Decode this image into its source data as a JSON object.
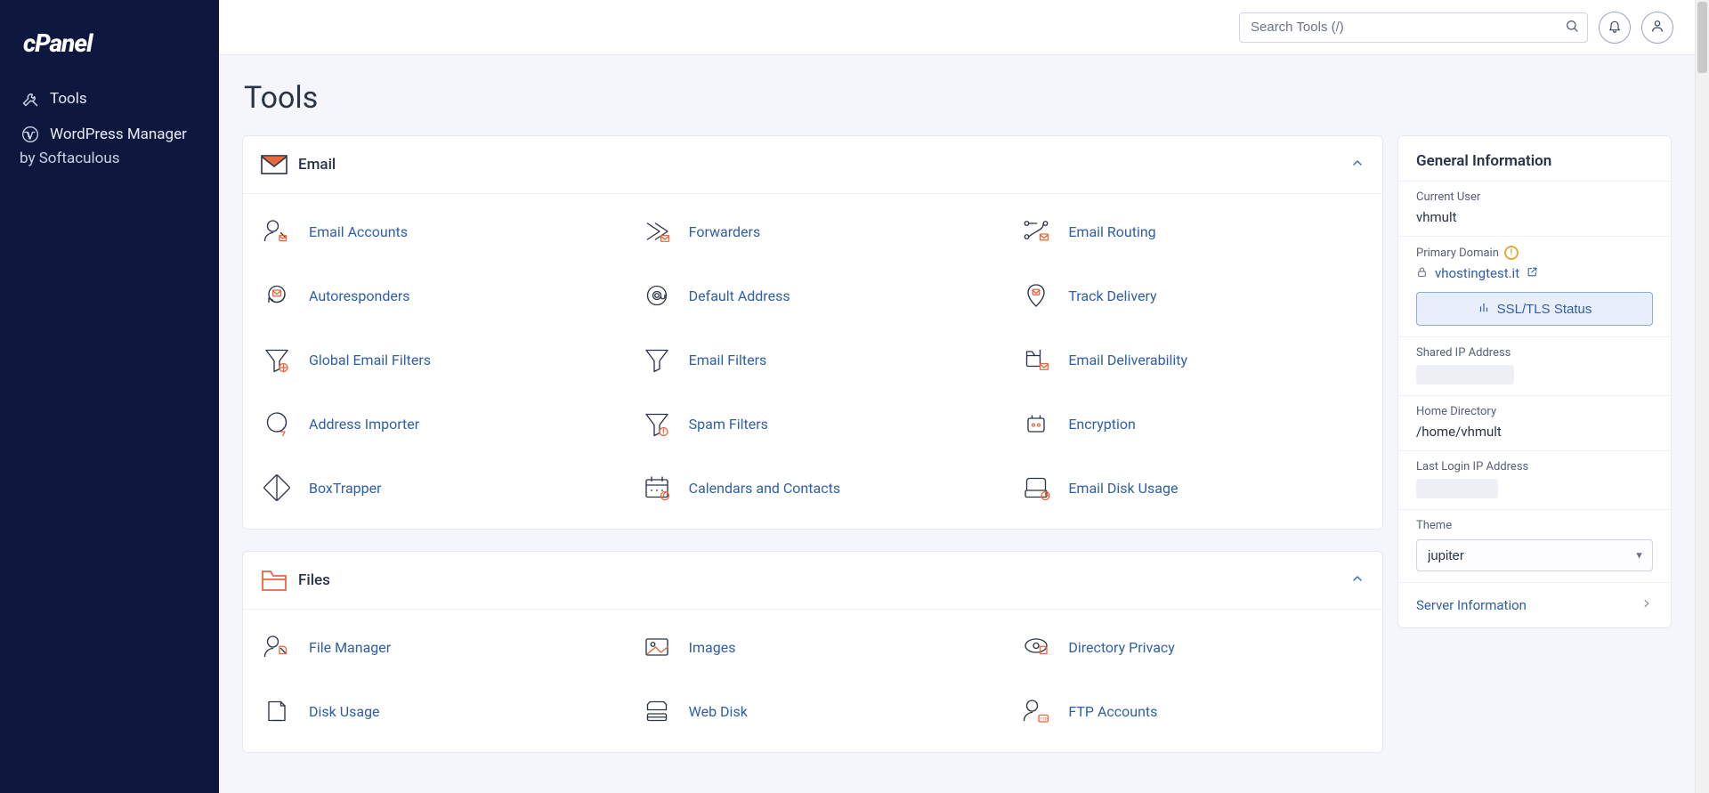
{
  "brand": {
    "name": "cPanel"
  },
  "sidebar": {
    "items": [
      {
        "label": "Tools",
        "icon": "tools"
      },
      {
        "label": "WordPress Manager by Softaculous",
        "icon": "wordpress",
        "label_line1": "WordPress Manager",
        "label_line2": "by Softaculous"
      }
    ]
  },
  "header": {
    "search_placeholder": "Search Tools (/)"
  },
  "page": {
    "title": "Tools"
  },
  "sections": [
    {
      "id": "email",
      "title": "Email",
      "items": [
        {
          "label": "Email Accounts"
        },
        {
          "label": "Forwarders"
        },
        {
          "label": "Email Routing"
        },
        {
          "label": "Autoresponders"
        },
        {
          "label": "Default Address"
        },
        {
          "label": "Track Delivery"
        },
        {
          "label": "Global Email Filters"
        },
        {
          "label": "Email Filters"
        },
        {
          "label": "Email Deliverability"
        },
        {
          "label": "Address Importer"
        },
        {
          "label": "Spam Filters"
        },
        {
          "label": "Encryption"
        },
        {
          "label": "BoxTrapper"
        },
        {
          "label": "Calendars and Contacts"
        },
        {
          "label": "Email Disk Usage"
        }
      ]
    },
    {
      "id": "files",
      "title": "Files",
      "items": [
        {
          "label": "File Manager"
        },
        {
          "label": "Images"
        },
        {
          "label": "Directory Privacy"
        },
        {
          "label": "Disk Usage"
        },
        {
          "label": "Web Disk"
        },
        {
          "label": "FTP Accounts"
        }
      ]
    }
  ],
  "info": {
    "heading": "General Information",
    "current_user_label": "Current User",
    "current_user_value": "vhmult",
    "primary_domain_label": "Primary Domain",
    "primary_domain_value": "vhostingtest.it",
    "ssl_button": "SSL/TLS Status",
    "shared_ip_label": "Shared IP Address",
    "home_dir_label": "Home Directory",
    "home_dir_value": "/home/vhmult",
    "last_login_label": "Last Login IP Address",
    "theme_label": "Theme",
    "theme_value": "jupiter",
    "server_info_label": "Server Information"
  }
}
